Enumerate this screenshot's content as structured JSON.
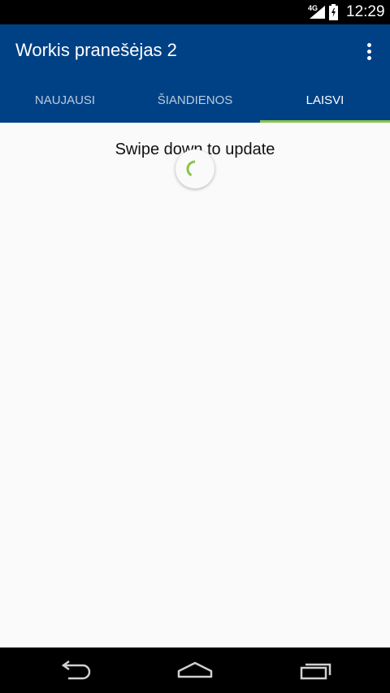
{
  "status_bar": {
    "network": "4G",
    "time": "12:29",
    "icons": [
      "signal-icon",
      "battery-charging-icon"
    ]
  },
  "app_bar": {
    "title": "Workis pranešėjas 2",
    "overflow_icon": "more-vert-icon"
  },
  "tabs": [
    {
      "label": "NAUJAUSI",
      "active": false
    },
    {
      "label": "ŠIANDIENOS",
      "active": false
    },
    {
      "label": "LAISVI",
      "active": true
    }
  ],
  "content": {
    "pull_hint": "Swipe down to update",
    "spinner_icon": "refresh-spinner-icon"
  },
  "nav_bar": {
    "icons": [
      "back-icon",
      "home-icon",
      "recents-icon"
    ]
  },
  "colors": {
    "primary": "#004185",
    "accent": "#8bc34a",
    "background": "#fafafa"
  }
}
